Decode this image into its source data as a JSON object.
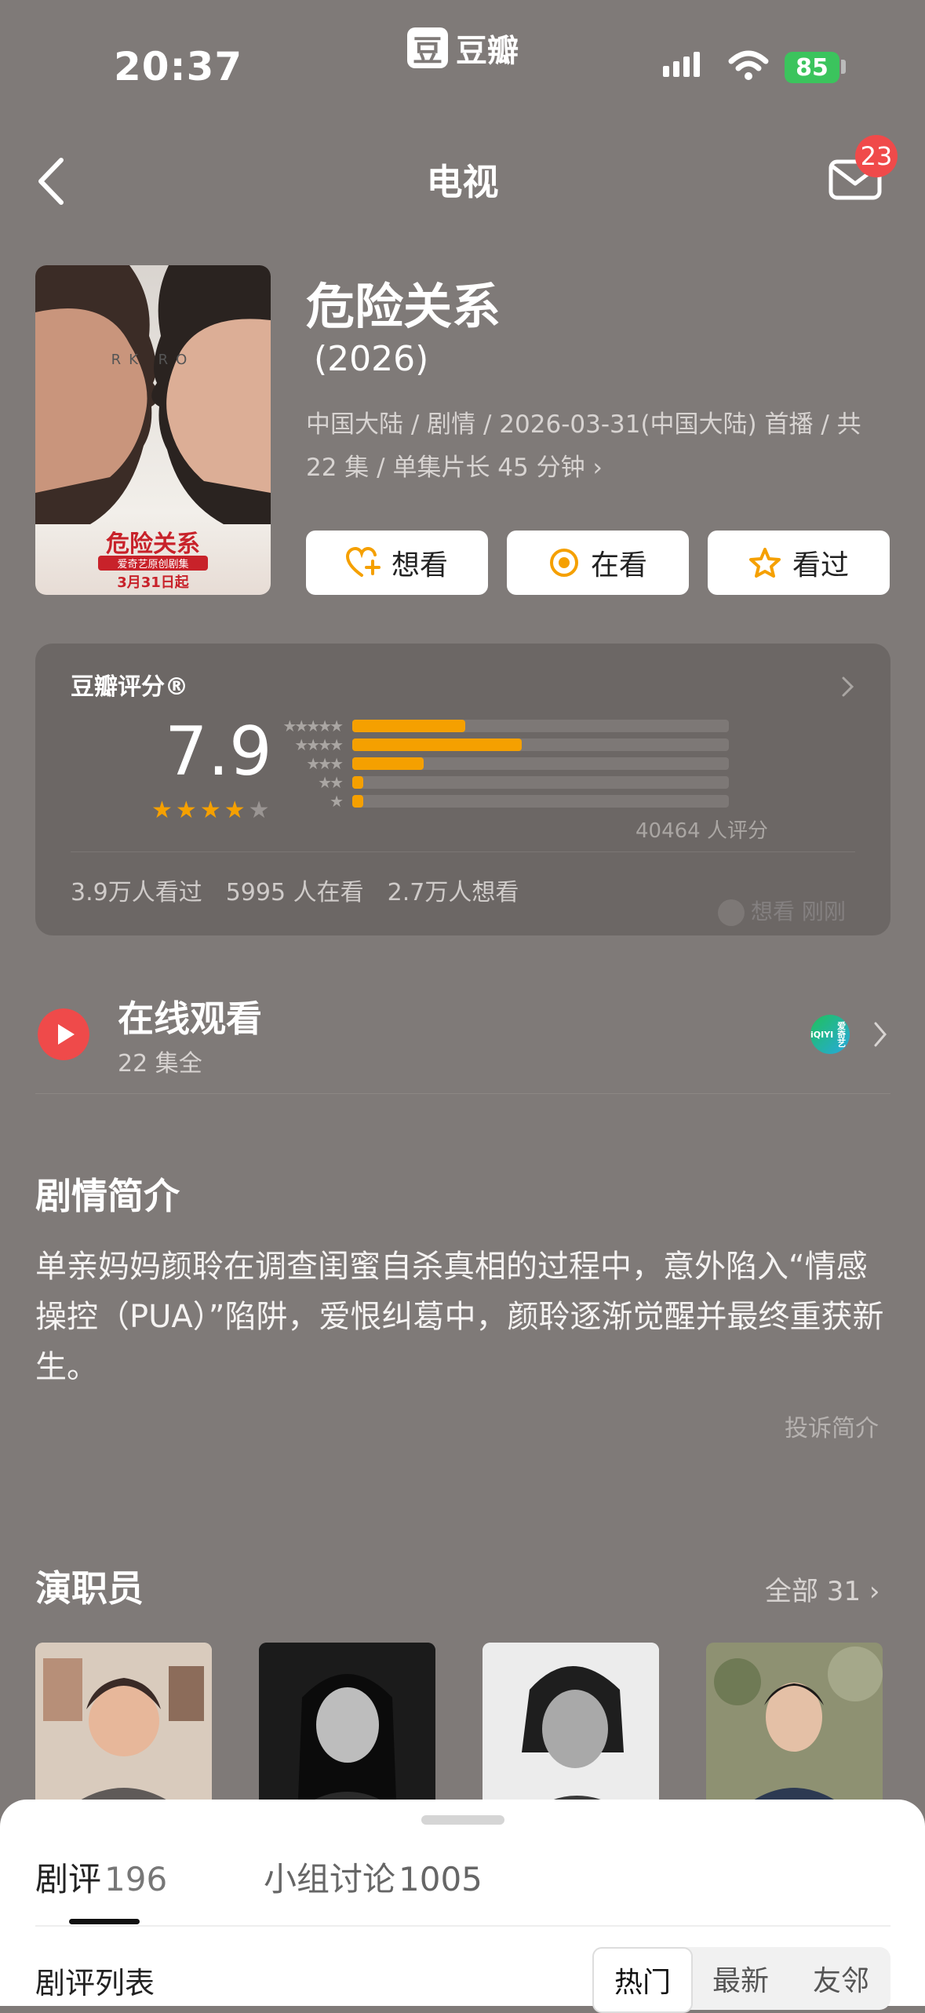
{
  "status_bar": {
    "time": "20:37",
    "app_name": "豆瓣",
    "app_logo_char": "豆",
    "battery": "85"
  },
  "nav": {
    "title": "电视",
    "badge_count": "23"
  },
  "show": {
    "title": "危险关系",
    "year": "(2026)",
    "meta": "中国大陆 / 剧情 / 2026-03-31(中国大陆) 首播 / 共 22 集 / 单集片长 45 分钟",
    "poster": {
      "title": "危险关系",
      "caption_top": "RK RO",
      "sub": "爱奇艺原创剧集",
      "date": "3月31日起"
    },
    "actions": [
      {
        "label": "想看",
        "icon": "heart-plus-icon"
      },
      {
        "label": "在看",
        "icon": "target-icon"
      },
      {
        "label": "看过",
        "icon": "star-icon"
      }
    ]
  },
  "rating": {
    "title": "豆瓣评分®",
    "score": "7.9",
    "stars_filled": 4,
    "stars_total": 5,
    "distribution": [
      {
        "stars": 5,
        "fraction": 0.3
      },
      {
        "stars": 4,
        "fraction": 0.45
      },
      {
        "stars": 3,
        "fraction": 0.19
      },
      {
        "stars": 2,
        "fraction": 0.03
      },
      {
        "stars": 1,
        "fraction": 0.03
      }
    ],
    "votes": "40464 人评分",
    "stats": [
      "3.9万人看过",
      "5995 人在看",
      "2.7万人想看"
    ],
    "recent_activity": "想看 刚刚",
    "accent_color": "#f5a000"
  },
  "online": {
    "title": "在线观看",
    "subtitle": "22 集全",
    "platform": "爱奇艺",
    "platform_logo": "iQIYI"
  },
  "summary": {
    "title": "剧情简介",
    "text": "单亲妈妈颜聆在调查闺蜜自杀真相的过程中，意外陷入“情感操控（PUA）”陷阱，爱恨纠葛中，颜聆逐渐觉醒并最终重获新生。",
    "report": "投诉简介"
  },
  "cast": {
    "title": "演职员",
    "all": "全部 31"
  },
  "sheet": {
    "tabs": [
      {
        "label": "剧评",
        "count": "196"
      },
      {
        "label": "小组讨论",
        "count": "1005"
      }
    ],
    "list_title": "剧评列表",
    "filters": [
      "热门",
      "最新",
      "友邻"
    ],
    "active_filter": "热门"
  }
}
